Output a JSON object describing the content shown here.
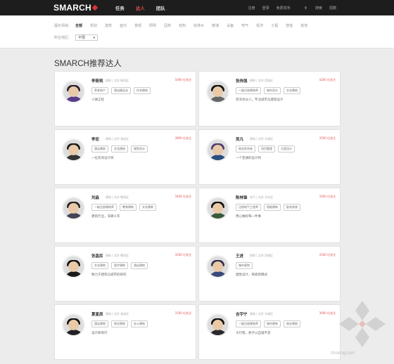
{
  "header": {
    "logo": "SMARCH",
    "nav": [
      "任务",
      "达人",
      "团队"
    ],
    "right": [
      "注册",
      "登录",
      "免费发布",
      "搜索",
      "招聘"
    ]
  },
  "filters": {
    "row1": {
      "label": "擅长领域：",
      "options": [
        "全部",
        "规划",
        "建筑",
        "室内",
        "景观",
        "照明",
        "园林",
        "结构",
        "给排水",
        "暖通",
        "设备",
        "电气",
        "经济",
        "工程",
        "智能",
        "其他"
      ],
      "selected": "全部"
    },
    "row2": {
      "label": "所在地区：",
      "value": "不限"
    }
  },
  "section_title": "SMARCH推荐达人",
  "cards": [
    {
      "name": "李筱筑",
      "meta": "建筑 | 北京 朝阳区",
      "fans": "5000 位关注",
      "tags": [
        "养老地产",
        "酒店精品化",
        "住宅建筑"
      ],
      "desc": "人微言轻",
      "c": "#5a3a8a",
      "h": "#2a2030"
    },
    {
      "name": "张伟强",
      "meta": "建筑 | 北京 西城区",
      "fans": "4200 位关注",
      "tags": [
        "一级注册建筑师",
        "城市设计",
        "文化建筑"
      ],
      "desc": "资深合伙人，专注城市与建筑设计",
      "c": "#666",
      "h": "#111"
    },
    {
      "name": "李宏",
      "meta": "建筑 | 北京 海淀区",
      "fans": "3800 位关注",
      "tags": [
        "酒店建筑",
        "文化建筑",
        "规划设计"
      ],
      "desc": "一位资深设计师",
      "c": "#333",
      "h": "#1a1a1a"
    },
    {
      "name": "吴凡",
      "meta": "建筑 | 北京 东城区",
      "fans": "3500 位关注",
      "tags": [
        "商业综合体",
        "项目管理",
        "方案设计"
      ],
      "desc": "一个普通的设计师",
      "c": "#2a5080",
      "h": "#4a3a70"
    },
    {
      "name": "刘淼",
      "meta": "建筑 | 北京 朝阳区",
      "fans": "3400 位关注",
      "tags": [
        "一级注册建筑师",
        "教育建筑",
        "文化建筑"
      ],
      "desc": "建筑行业，深耕十年",
      "c": "#445",
      "h": "#222"
    },
    {
      "name": "陈林锋",
      "meta": "电气 | 北京 丰台区",
      "fans": "3200 位关注",
      "tags": [
        "注册电气工程师",
        "智能建筑",
        "配电系统"
      ],
      "desc": "用心做好每一件事",
      "c": "#3a5a3a",
      "h": "#111"
    },
    {
      "name": "张昌民",
      "meta": "建筑 | 北京 朝阳区",
      "fans": "3200 位关注",
      "tags": [
        "文化建筑",
        "医疗建筑",
        "酒店建筑"
      ],
      "desc": "致力于建筑与城市的研究",
      "c": "#1a1a1a",
      "h": "#111"
    },
    {
      "name": "王进",
      "meta": "规划 | 北京 西城区",
      "fans": "3100 位关注",
      "tags": [
        "城市规划"
      ],
      "desc": "理性设计，探索新模式",
      "c": "#3a4a7a",
      "h": "#30304a"
    },
    {
      "name": "夏星辰",
      "meta": "建筑 | 北京 海淀区",
      "fans": "3100 位关注",
      "tags": [
        "酒店建筑",
        "商业建筑",
        "办公建筑"
      ],
      "desc": "设计即修行",
      "c": "#222",
      "h": "#111"
    },
    {
      "name": "吉宇宁",
      "meta": "建筑 | 北京 东城区",
      "fans": "3000 位关注",
      "tags": [
        "一级注册建筑师",
        "城市更新",
        "商业建筑"
      ],
      "desc": "大行者，君子以自强不息",
      "c": "#2a2a2a",
      "h": "#111"
    }
  ]
}
